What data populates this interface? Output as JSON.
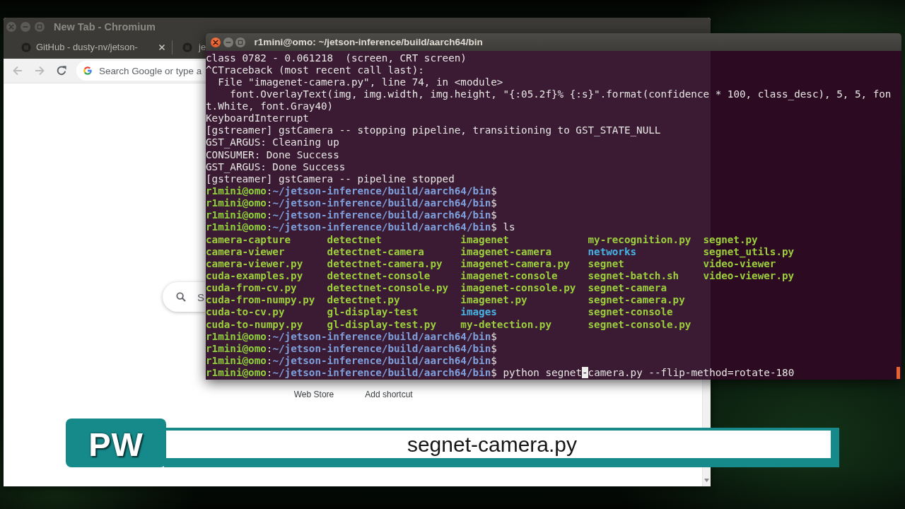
{
  "browser": {
    "title": "New Tab - Chromium",
    "focused": false,
    "tabs": [
      {
        "title": "GitHub - dusty-nv/jetson-",
        "closable": true
      },
      {
        "title": "je",
        "closable": false
      }
    ],
    "nav_buttons": [
      {
        "kind": "back",
        "disabled": true
      },
      {
        "kind": "forward",
        "disabled": true
      },
      {
        "kind": "reload",
        "disabled": false
      }
    ],
    "omnibox": {
      "placeholder": "Search Google or type a"
    },
    "search": {
      "placeholder": "S"
    },
    "shortcuts": [
      {
        "label": "Web Store"
      },
      {
        "label": "Add shortcut"
      }
    ]
  },
  "terminal": {
    "title": "r1mini@omo: ~/jetson-inference/build/aarch64/bin",
    "focused": true,
    "lines": [
      {
        "kind": "output",
        "text": "class 0782 - 0.061218  (screen, CRT screen)"
      },
      {
        "kind": "output",
        "text": "^CTraceback (most recent call last):"
      },
      {
        "kind": "output",
        "text": "  File \"imagenet-camera.py\", line 74, in <module>"
      },
      {
        "kind": "output",
        "text": "    font.OverlayText(img, img.width, img.height, \"{:05.2f}% {:s}\".format(confidence * 100, class_desc), 5, 5, fon"
      },
      {
        "kind": "output",
        "text": "t.White, font.Gray40)"
      },
      {
        "kind": "output",
        "text": "KeyboardInterrupt"
      },
      {
        "kind": "output",
        "text": "[gstreamer] gstCamera -- stopping pipeline, transitioning to GST_STATE_NULL"
      },
      {
        "kind": "output",
        "text": "GST_ARGUS: Cleaning up"
      },
      {
        "kind": "output",
        "text": "CONSUMER: Done Success"
      },
      {
        "kind": "output",
        "text": "GST_ARGUS: Done Success"
      },
      {
        "kind": "output",
        "text": "[gstreamer] gstCamera -- pipeline stopped"
      },
      {
        "kind": "prompt",
        "user": "r1mini@omo",
        "separator": ":",
        "path": "~/jetson-inference/build/aarch64/bin",
        "symbol": "$"
      },
      {
        "kind": "prompt",
        "user": "r1mini@omo",
        "separator": ":",
        "path": "~/jetson-inference/build/aarch64/bin",
        "symbol": "$"
      },
      {
        "kind": "prompt",
        "user": "r1mini@omo",
        "separator": ":",
        "path": "~/jetson-inference/build/aarch64/bin",
        "symbol": "$"
      },
      {
        "kind": "prompt",
        "user": "r1mini@omo",
        "separator": ":",
        "path": "~/jetson-inference/build/aarch64/bin",
        "symbol": "$",
        "command": "ls"
      },
      {
        "kind": "listing",
        "columns": [
          [
            {
              "name": "camera-capture",
              "kind": "file"
            },
            {
              "name": "camera-viewer",
              "kind": "file"
            },
            {
              "name": "camera-viewer.py",
              "kind": "file"
            },
            {
              "name": "cuda-examples.py",
              "kind": "file"
            },
            {
              "name": "cuda-from-cv.py",
              "kind": "file"
            },
            {
              "name": "cuda-from-numpy.py",
              "kind": "file"
            },
            {
              "name": "cuda-to-cv.py",
              "kind": "file"
            },
            {
              "name": "cuda-to-numpy.py",
              "kind": "file"
            }
          ],
          [
            {
              "name": "detectnet",
              "kind": "file"
            },
            {
              "name": "detectnet-camera",
              "kind": "file"
            },
            {
              "name": "detectnet-camera.py",
              "kind": "file"
            },
            {
              "name": "detectnet-console",
              "kind": "file"
            },
            {
              "name": "detectnet-console.py",
              "kind": "file"
            },
            {
              "name": "detectnet.py",
              "kind": "file"
            },
            {
              "name": "gl-display-test",
              "kind": "file"
            },
            {
              "name": "gl-display-test.py",
              "kind": "file"
            }
          ],
          [
            {
              "name": "imagenet",
              "kind": "file"
            },
            {
              "name": "imagenet-camera",
              "kind": "file"
            },
            {
              "name": "imagenet-camera.py",
              "kind": "file"
            },
            {
              "name": "imagenet-console",
              "kind": "file"
            },
            {
              "name": "imagenet-console.py",
              "kind": "file"
            },
            {
              "name": "imagenet.py",
              "kind": "file"
            },
            {
              "name": "images",
              "kind": "directory"
            },
            {
              "name": "my-detection.py",
              "kind": "file"
            }
          ],
          [
            {
              "name": "my-recognition.py",
              "kind": "file"
            },
            {
              "name": "networks",
              "kind": "directory"
            },
            {
              "name": "segnet",
              "kind": "file"
            },
            {
              "name": "segnet-batch.sh",
              "kind": "file"
            },
            {
              "name": "segnet-camera",
              "kind": "file"
            },
            {
              "name": "segnet-camera.py",
              "kind": "file"
            },
            {
              "name": "segnet-console",
              "kind": "file"
            },
            {
              "name": "segnet-console.py",
              "kind": "file"
            }
          ],
          [
            {
              "name": "segnet.py",
              "kind": "file"
            },
            {
              "name": "segnet_utils.py",
              "kind": "file"
            },
            {
              "name": "video-viewer",
              "kind": "file"
            },
            {
              "name": "video-viewer.py",
              "kind": "file"
            }
          ]
        ]
      },
      {
        "kind": "prompt",
        "user": "r1mini@omo",
        "separator": ":",
        "path": "~/jetson-inference/build/aarch64/bin",
        "symbol": "$"
      },
      {
        "kind": "prompt",
        "user": "r1mini@omo",
        "separator": ":",
        "path": "~/jetson-inference/build/aarch64/bin",
        "symbol": "$"
      },
      {
        "kind": "prompt",
        "user": "r1mini@omo",
        "separator": ":",
        "path": "~/jetson-inference/build/aarch64/bin",
        "symbol": "$"
      },
      {
        "kind": "prompt",
        "user": "r1mini@omo",
        "separator": ":",
        "path": "~/jetson-inference/build/aarch64/bin",
        "symbol": "$",
        "command": "python segnet",
        "cursor": "-",
        "command_rest": "camera.py --flip-method=rotate-180"
      }
    ]
  },
  "caption": {
    "logo": "PW",
    "text": "segnet-camera.py"
  }
}
